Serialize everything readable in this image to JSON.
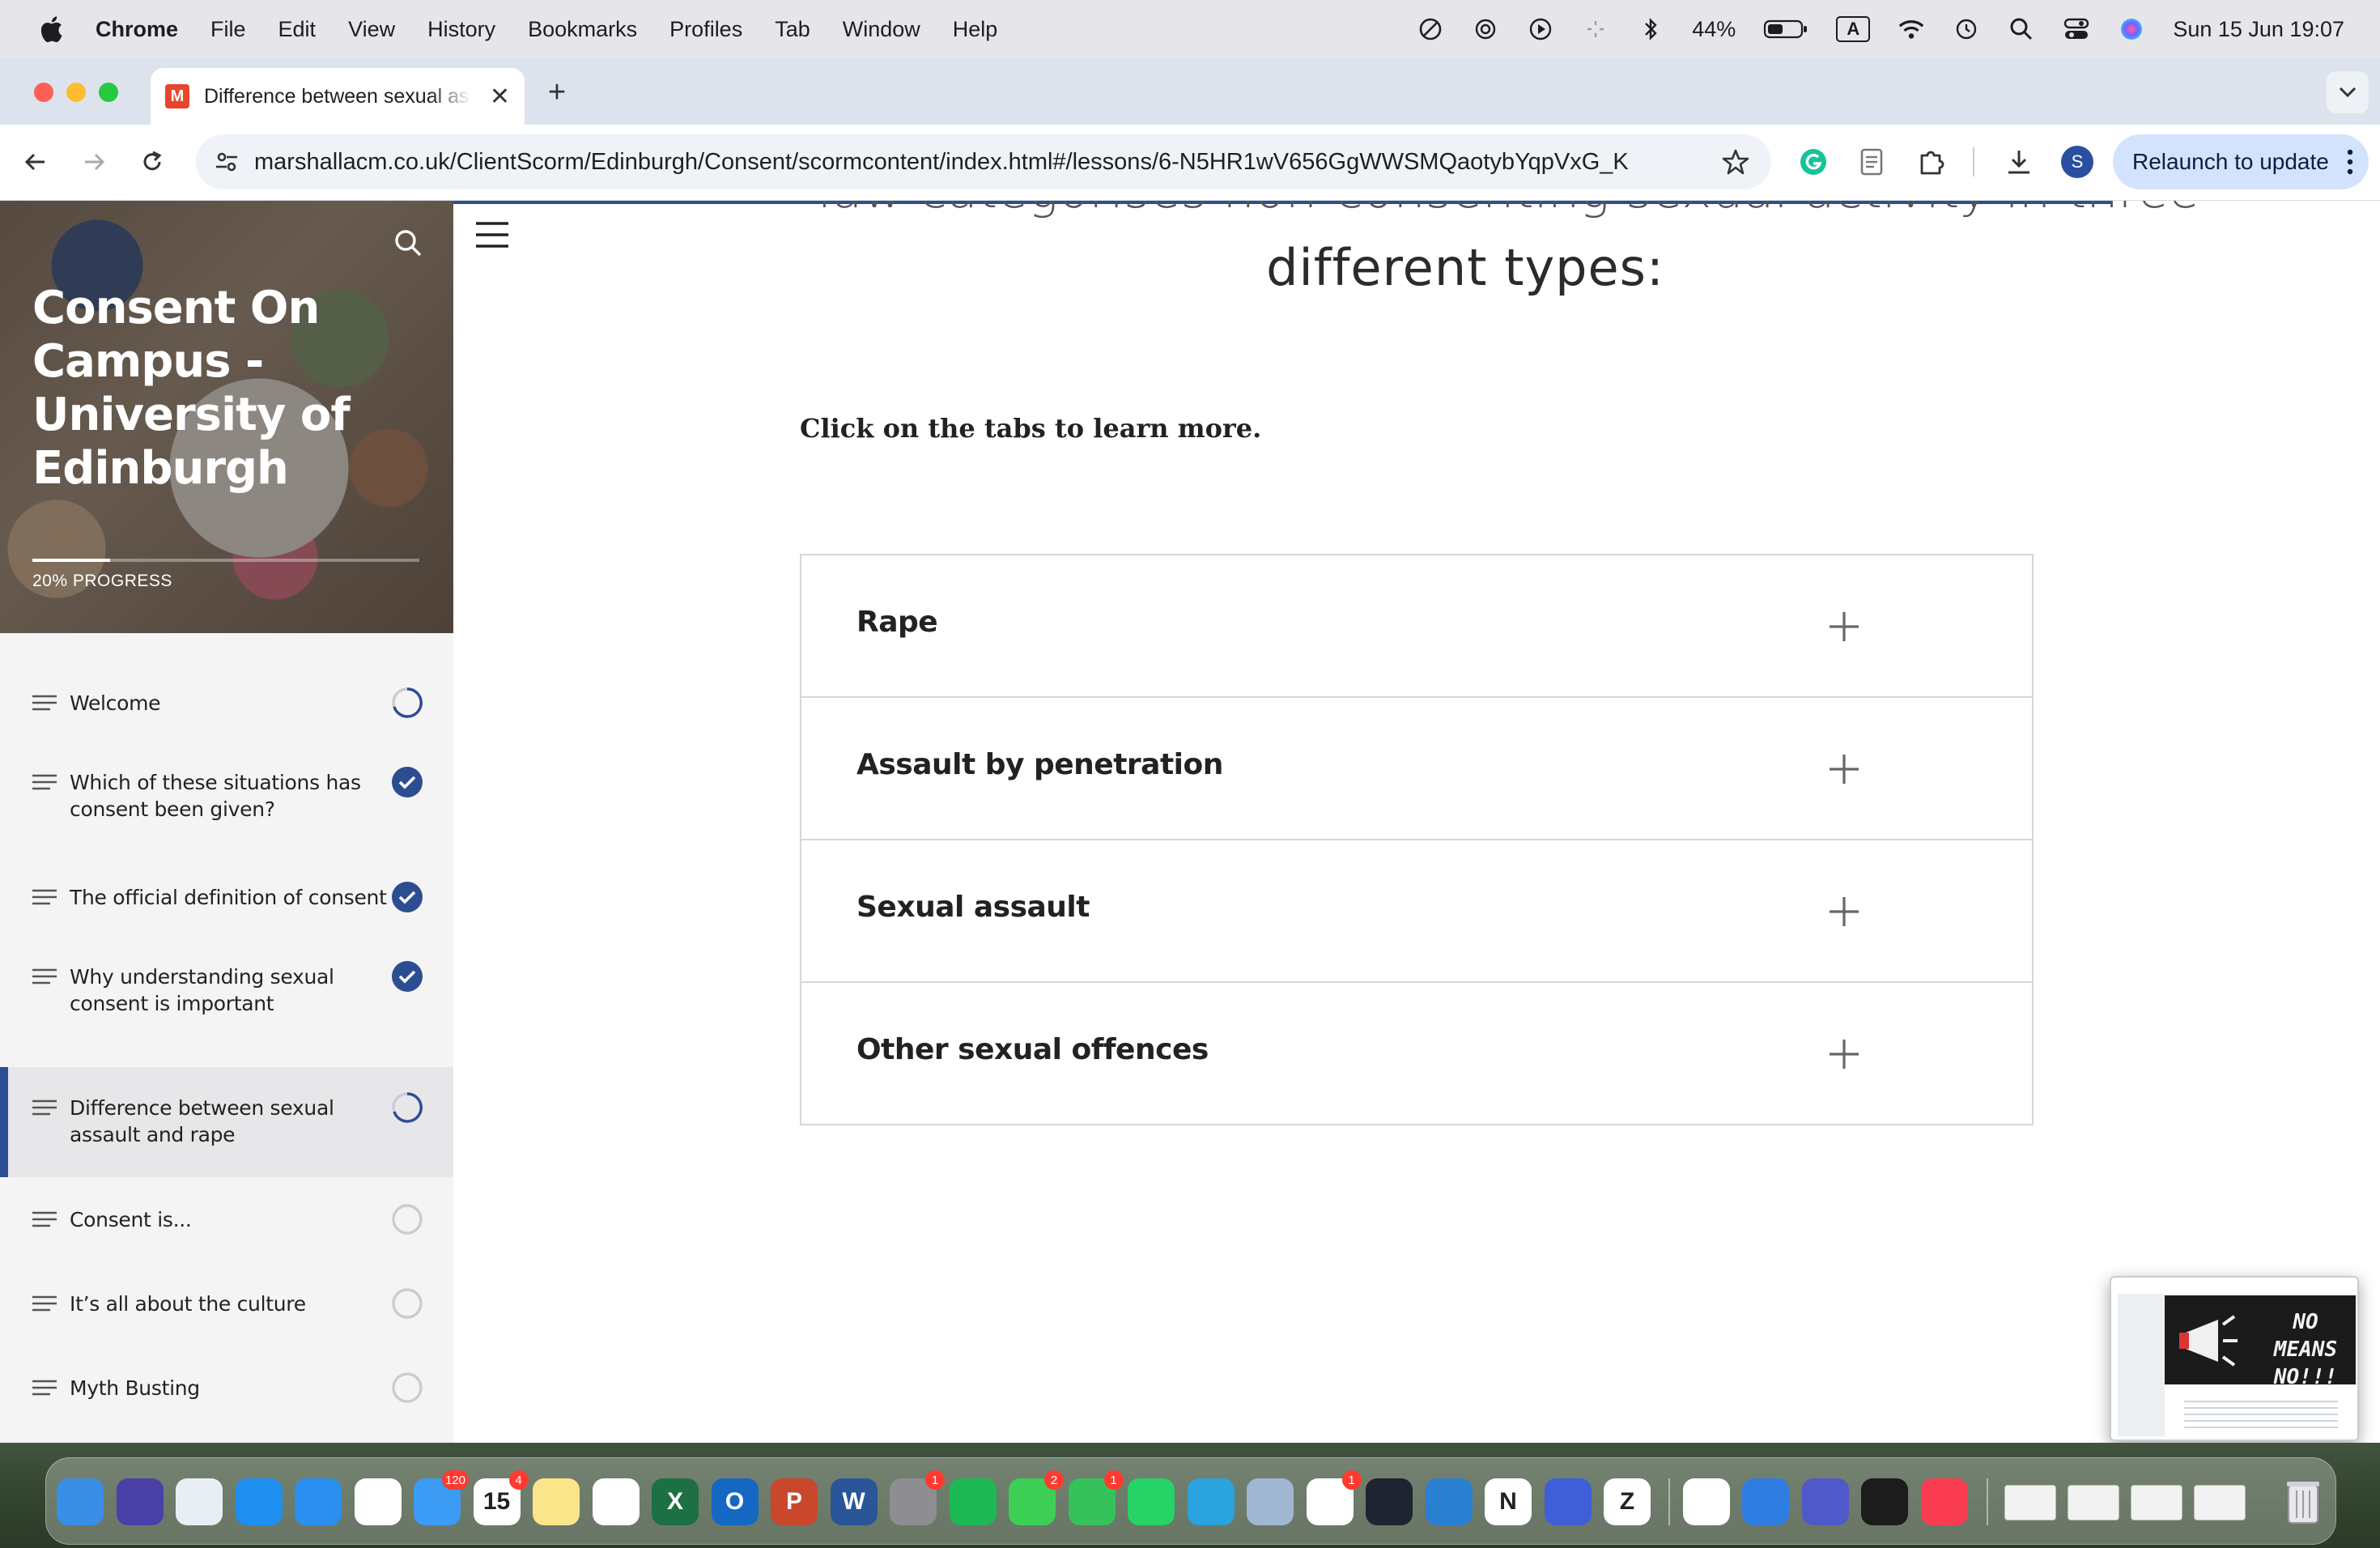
{
  "menubar": {
    "app": "Chrome",
    "items": [
      "File",
      "Edit",
      "View",
      "History",
      "Bookmarks",
      "Profiles",
      "Tab",
      "Window",
      "Help"
    ],
    "battery": "44%",
    "input_source": "A",
    "datetime": "Sun 15 Jun  19:07"
  },
  "browser": {
    "tab_title": "Difference between sexual assault and rape",
    "favicon_letter": "M",
    "url": "marshallacm.co.uk/ClientScorm/Edinburgh/Consent/scormcontent/index.html#/lessons/6-N5HR1wV656GgWWSMQaotybYqpVxG_K",
    "profile_initial": "S",
    "relaunch_label": "Relaunch to update"
  },
  "course": {
    "title": "Consent On Campus - University of Edinburgh",
    "progress_label": "20% PROGRESS",
    "progress_fraction": 0.2,
    "lessons": [
      {
        "label": "Welcome",
        "status": "in-progress"
      },
      {
        "label": "Which of these situations has consent been given?",
        "status": "complete"
      },
      {
        "label": "The official definition of consent",
        "status": "complete"
      },
      {
        "label": "Why understanding sexual consent is important",
        "status": "complete"
      },
      {
        "label": "Difference between sexual assault and rape",
        "status": "in-progress",
        "active": true
      },
      {
        "label": "Consent is...",
        "status": "not-started"
      },
      {
        "label": "It’s all about the culture",
        "status": "not-started"
      },
      {
        "label": "Myth Busting",
        "status": "not-started"
      }
    ]
  },
  "main": {
    "clipped_heading": "law categorises non-consenting sexual activity in three",
    "heading": "different types:",
    "instruction": "Click on the tabs to learn more.",
    "accordion": [
      "Rape",
      "Assault by penetration",
      "Sexual assault",
      "Other sexual offences"
    ]
  },
  "thumbnail": {
    "banner_text": "NO MEANS NO!!!"
  },
  "dock": {
    "apps": [
      {
        "name": "finder-icon",
        "color": "#3a8ee6"
      },
      {
        "name": "siri-icon",
        "color": "#4b3fa8"
      },
      {
        "name": "launchpad-icon",
        "color": "#e9eef5"
      },
      {
        "name": "app-store-icon",
        "color": "#1f8ef1"
      },
      {
        "name": "safari-icon",
        "color": "#2a8ff0"
      },
      {
        "name": "chrome-icon",
        "color": "#ffffff"
      },
      {
        "name": "mail-icon",
        "color": "#3b9bf5",
        "badge": "120"
      },
      {
        "name": "calendar-icon",
        "color": "#ffffff",
        "badge": "4",
        "text": "15"
      },
      {
        "name": "notes-icon",
        "color": "#fbe58a"
      },
      {
        "name": "photos-icon",
        "color": "#ffffff"
      },
      {
        "name": "excel-icon",
        "color": "#1d7044",
        "text": "X"
      },
      {
        "name": "outlook-icon",
        "color": "#1468c3",
        "text": "O"
      },
      {
        "name": "powerpoint-icon",
        "color": "#c9472b",
        "text": "P"
      },
      {
        "name": "word-icon",
        "color": "#2a5699",
        "text": "W"
      },
      {
        "name": "system-settings-icon",
        "color": "#8d8d92",
        "badge": "1"
      },
      {
        "name": "spotify-icon",
        "color": "#1db954"
      },
      {
        "name": "messages-icon",
        "color": "#3dcf55",
        "badge": "2"
      },
      {
        "name": "facetime-icon",
        "color": "#35c25a",
        "badge": "1"
      },
      {
        "name": "whatsapp-icon",
        "color": "#25d366"
      },
      {
        "name": "telegram-icon",
        "color": "#2aa3df"
      },
      {
        "name": "preview-icon",
        "color": "#9fb7d0"
      },
      {
        "name": "slack-icon",
        "color": "#ffffff",
        "badge": "1"
      },
      {
        "name": "cursor-icon",
        "color": "#1e2430"
      },
      {
        "name": "vscode-icon",
        "color": "#2a7fd1"
      },
      {
        "name": "notion-icon",
        "color": "#ffffff",
        "text": "N"
      },
      {
        "name": "nordvpn-icon",
        "color": "#3e5fd8"
      },
      {
        "name": "zotero-icon",
        "color": "#ffffff",
        "text": "Z"
      },
      {
        "name": "chatgpt-icon",
        "color": "#ffffff"
      },
      {
        "name": "keynote-icon",
        "color": "#2f7de1"
      },
      {
        "name": "teams-icon",
        "color": "#5059c9"
      },
      {
        "name": "activity-monitor-icon",
        "color": "#1c1c1c"
      },
      {
        "name": "music-icon",
        "color": "#fa3c50"
      }
    ]
  }
}
